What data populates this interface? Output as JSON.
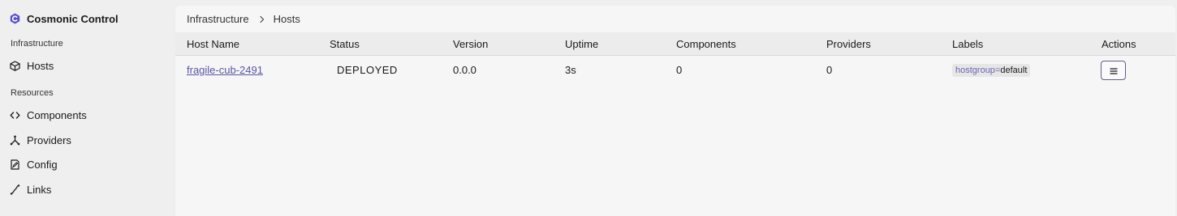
{
  "app": {
    "title": "Cosmonic Control",
    "accent": "#5b4fcf"
  },
  "sidebar": {
    "sections": [
      {
        "label": "Infrastructure",
        "items": [
          {
            "label": "Hosts",
            "icon": "cube-icon"
          }
        ]
      },
      {
        "label": "Resources",
        "items": [
          {
            "label": "Components",
            "icon": "code-icon"
          },
          {
            "label": "Providers",
            "icon": "fork-icon"
          },
          {
            "label": "Config",
            "icon": "config-file-icon"
          },
          {
            "label": "Links",
            "icon": "link-curve-icon"
          }
        ]
      }
    ]
  },
  "breadcrumb": {
    "items": [
      "Infrastructure",
      "Hosts"
    ]
  },
  "table": {
    "columns": [
      "Host Name",
      "Status",
      "Version",
      "Uptime",
      "Components",
      "Providers",
      "Labels",
      "Actions"
    ],
    "rows": [
      {
        "host_name": "fragile-cub-2491",
        "status": "DEPLOYED",
        "version": "0.0.0",
        "uptime": "3s",
        "components": "0",
        "providers": "0",
        "label_key": "hostgroup",
        "label_sep": "=",
        "label_value": "default",
        "action_icon": "menu-icon"
      }
    ]
  }
}
